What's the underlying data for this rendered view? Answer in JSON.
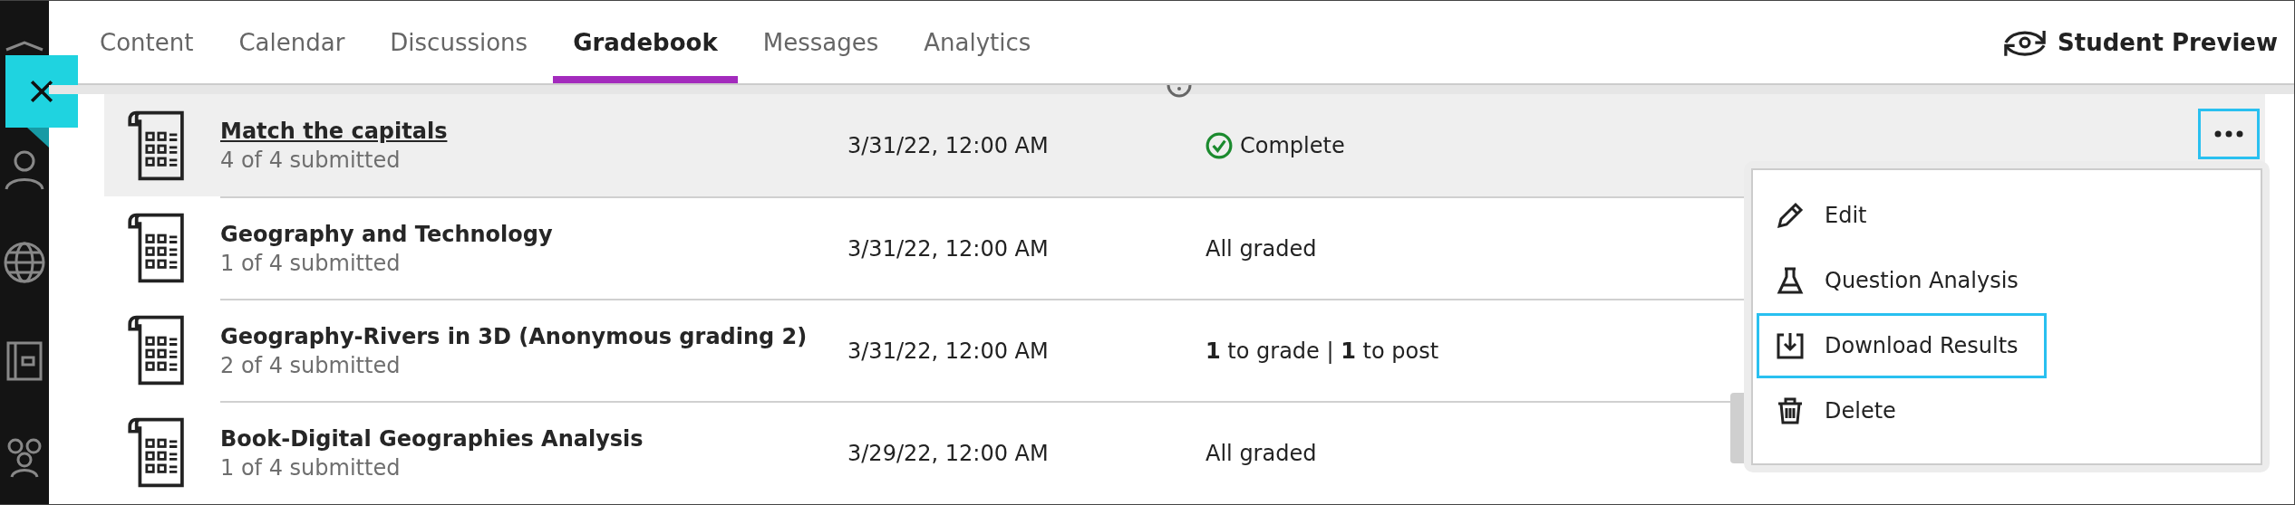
{
  "tabs": [
    {
      "label": "Content",
      "selected": false
    },
    {
      "label": "Calendar",
      "selected": false
    },
    {
      "label": "Discussions",
      "selected": false
    },
    {
      "label": "Gradebook",
      "selected": true
    },
    {
      "label": "Messages",
      "selected": false
    },
    {
      "label": "Analytics",
      "selected": false
    }
  ],
  "student_preview": {
    "label": "Student Preview"
  },
  "rows": [
    {
      "title": "Match the capitals",
      "submitted": "4 of 4 submitted",
      "due": "3/31/22, 12:00 AM",
      "status": "Complete",
      "kind": "complete",
      "selected": true
    },
    {
      "title": "Geography and Technology",
      "submitted": "1 of 4 submitted",
      "due": "3/31/22, 12:00 AM",
      "status": "All graded",
      "kind": "plain",
      "selected": false
    },
    {
      "title": "Geography-Rivers in 3D (Anonymous grading 2)",
      "submitted": "2 of 4 submitted",
      "due": "3/31/22, 12:00 AM",
      "status": "**1** to grade | **1** to post",
      "kind": "plain",
      "selected": false
    },
    {
      "title": "Book-Digital Geographies Analysis",
      "submitted": "1 of 4 submitted",
      "due": "3/29/22, 12:00 AM",
      "status": "All graded",
      "kind": "plain",
      "selected": false
    }
  ],
  "more_button": {
    "focused": true
  },
  "menu": [
    {
      "label": "Edit",
      "kind": "edit",
      "focused": false
    },
    {
      "label": "Question Analysis",
      "kind": "analysis",
      "focused": false
    },
    {
      "label": "Download Results",
      "kind": "download",
      "focused": true
    },
    {
      "label": "Delete",
      "kind": "delete",
      "focused": false
    }
  ]
}
